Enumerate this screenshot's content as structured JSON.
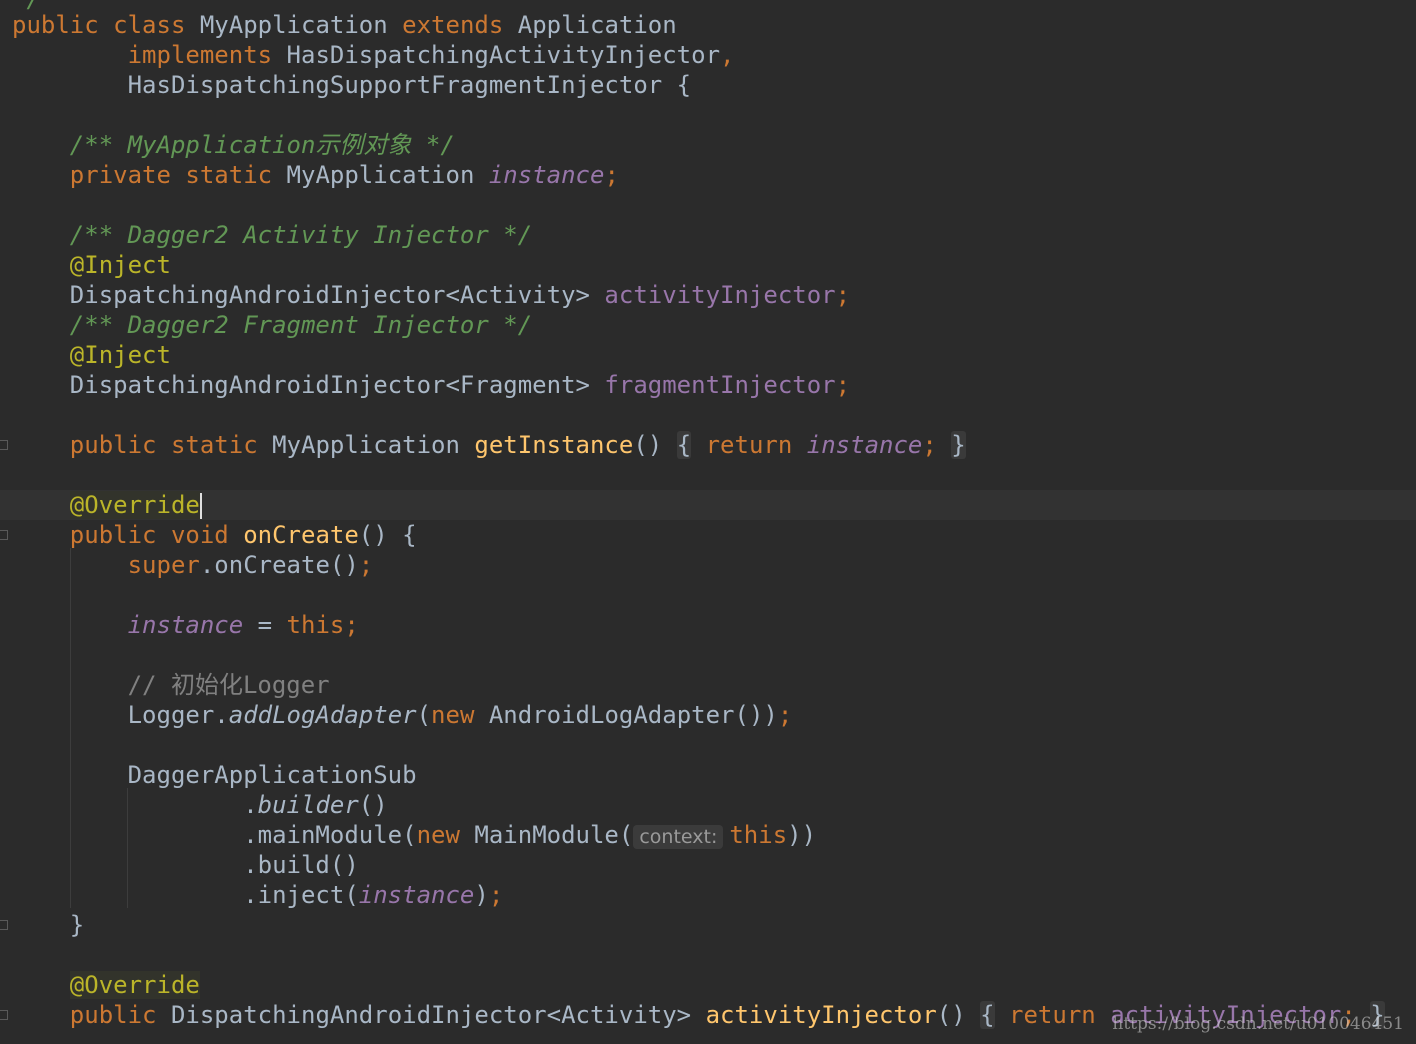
{
  "code": {
    "top_partial": "*/",
    "l1": {
      "kw_public": "public",
      "kw_class": "class",
      "class_name": "MyApplication",
      "kw_extends": "extends",
      "parent": "Application"
    },
    "l2": {
      "kw_implements": "implements",
      "iface1": "HasDispatchingActivityInjector",
      "comma": ","
    },
    "l3": {
      "iface2": "HasDispatchingSupportFragmentInjector {"
    },
    "l5": {
      "comment": "/** MyApplication示例对象 */"
    },
    "l6": {
      "kw": "private static",
      "type": "MyApplication",
      "field": "instance",
      "semi": ";"
    },
    "l8": {
      "comment": "/** Dagger2 Activity Injector */"
    },
    "l9": {
      "annotation": "@Inject"
    },
    "l10": {
      "type": "DispatchingAndroidInjector<Activity>",
      "field": "activityInjector",
      "semi": ";"
    },
    "l11": {
      "comment": "/** Dagger2 Fragment Injector */"
    },
    "l12": {
      "annotation": "@Inject"
    },
    "l13": {
      "type": "DispatchingAndroidInjector<Fragment>",
      "field": "fragmentInjector",
      "semi": ";"
    },
    "l15": {
      "kw": "public static",
      "type": "MyApplication",
      "method": "getInstance",
      "parens": "()",
      "open": "{",
      "kw_return": "return",
      "field": "instance",
      "semi": ";",
      "close": "}"
    },
    "l17": {
      "annotation": "@Override"
    },
    "l18": {
      "kw": "public void",
      "method": "onCreate",
      "rest": "() {"
    },
    "l19": {
      "kw_super": "super",
      "call": ".onCreate()",
      "semi": ";"
    },
    "l21": {
      "field": "instance",
      "eq": " = ",
      "kw_this": "this",
      "semi": ";"
    },
    "l23": {
      "comment": "// 初始化Logger"
    },
    "l24": {
      "obj": "Logger.",
      "static_method": "addLogAdapter",
      "paren": "(",
      "kw_new": "new",
      "ctor": "AndroidLogAdapter())",
      "semi": ";"
    },
    "l26": {
      "text": "DaggerApplicationSub"
    },
    "l27": {
      "dot": ".",
      "static_method": "builder",
      "parens": "()"
    },
    "l28": {
      "call": ".mainModule(",
      "kw_new": "new",
      "ctor": "MainModule(",
      "hint": "context:",
      "kw_this": "this",
      "close": "))"
    },
    "l29": {
      "call": ".build()"
    },
    "l30": {
      "call": ".inject(",
      "field": "instance",
      "close": ")",
      "semi": ";"
    },
    "l31": {
      "close": "}"
    },
    "l33": {
      "annotation": "@Override"
    },
    "l34": {
      "kw": "public",
      "type": "DispatchingAndroidInjector<Activity>",
      "method": "activityInjector",
      "parens": "()",
      "open": "{",
      "kw_return": "return",
      "field": "activityInjector",
      "semi": ";",
      "close": "}"
    }
  },
  "watermark": "https://blog.csdn.net/u010046451",
  "colors": {
    "background": "#2b2b2b",
    "keyword": "#cc7832",
    "comment": "#629755",
    "field": "#9876aa",
    "method": "#ffc66d",
    "annotation": "#bbb529",
    "text": "#a9b7c6"
  }
}
